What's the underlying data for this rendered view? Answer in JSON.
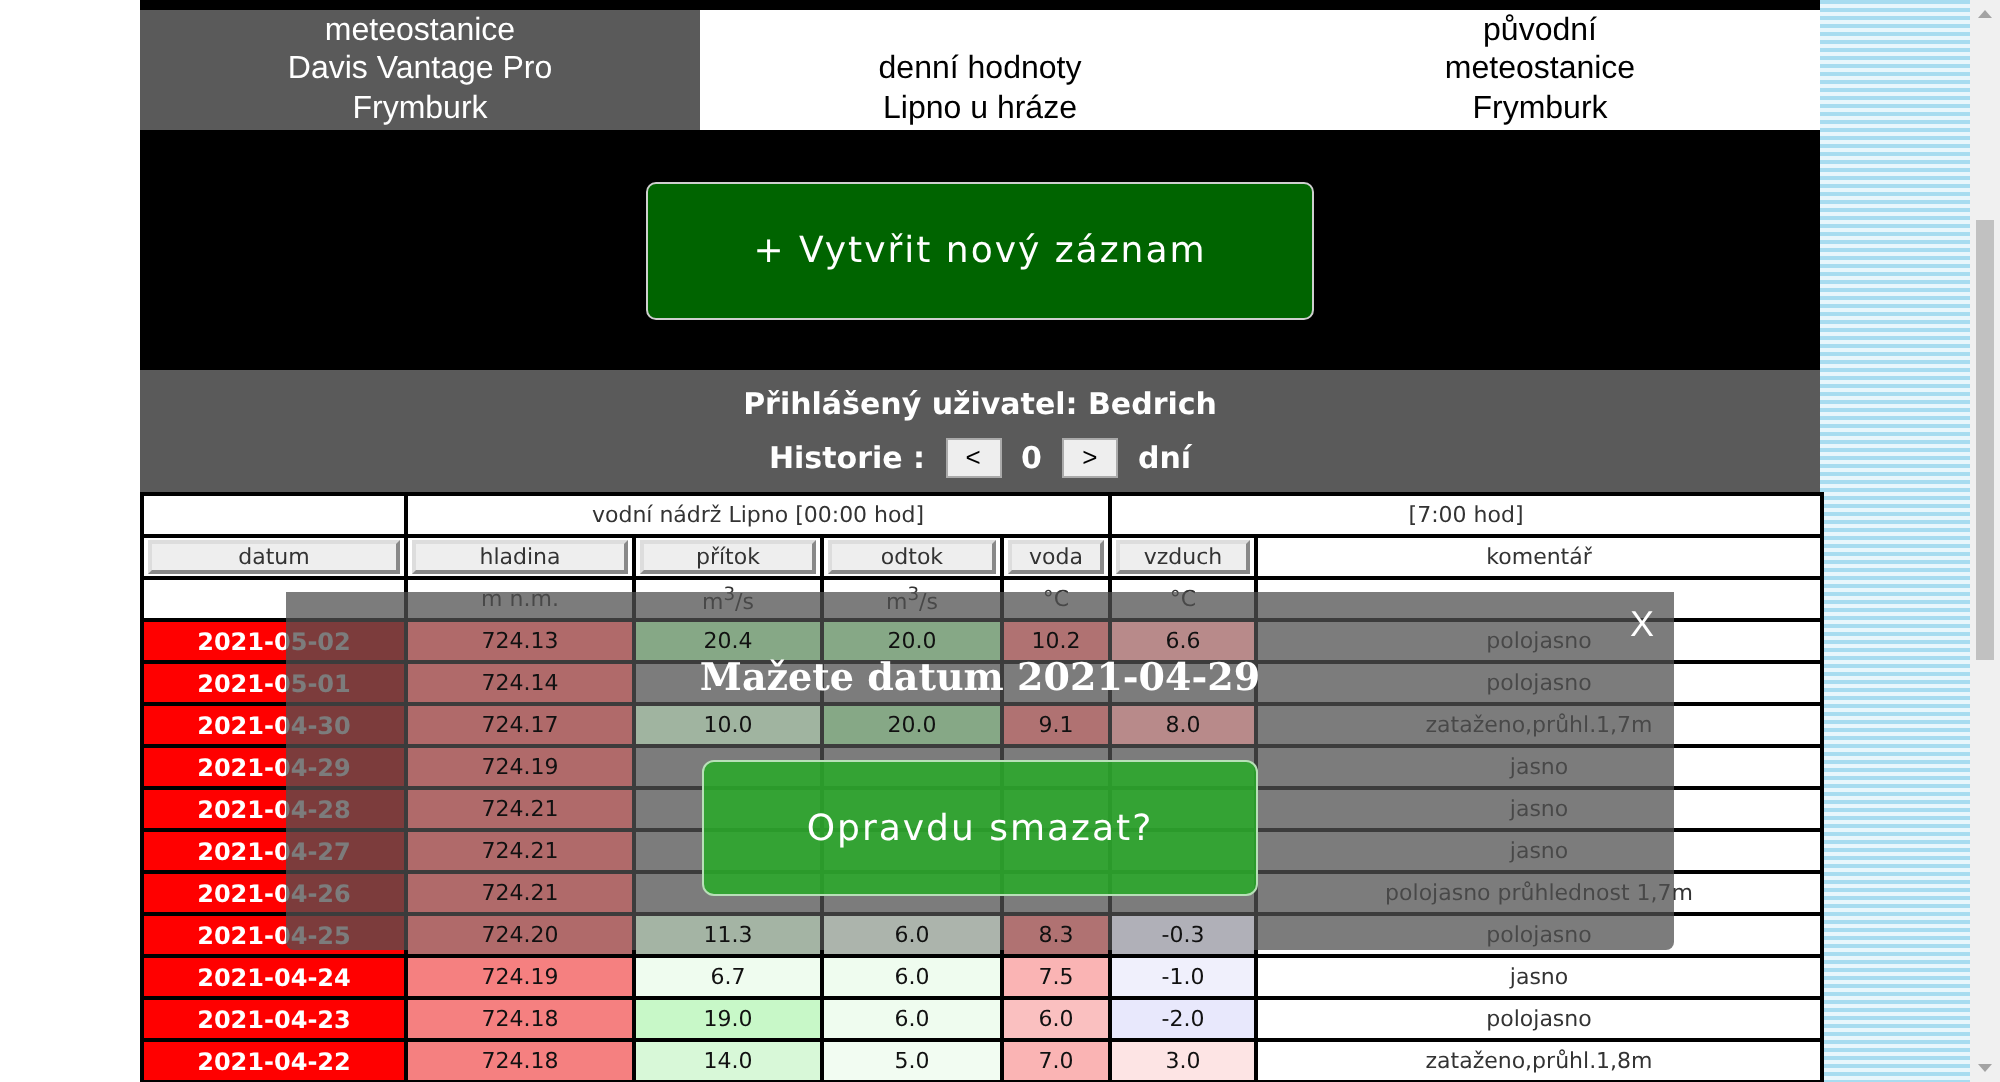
{
  "tabs": [
    {
      "lines": [
        "meteostanice",
        "Davis Vantage Pro",
        "Frymburk"
      ],
      "selected": true
    },
    {
      "lines": [
        "denní hodnoty",
        "Lipno u hráze"
      ],
      "selected": false
    },
    {
      "lines": [
        "původní",
        "meteostanice",
        "Frymburk"
      ],
      "selected": false
    }
  ],
  "create_button": "+ Vytvřit nový záznam",
  "user_label": "Přihlášený uživatel: Bedrich",
  "history": {
    "label": "Historie :",
    "prev": "<",
    "value": "0",
    "next": ">",
    "unit": "dní"
  },
  "table": {
    "groups": [
      "vodní nádrž Lipno [00:00 hod]",
      "[7:00 hod]"
    ],
    "columns": [
      {
        "label": "datum",
        "kind": "button"
      },
      {
        "label": "hladina",
        "kind": "button",
        "unit": "m n.m."
      },
      {
        "label": "přítok",
        "kind": "button",
        "unit": "m$^{3}$/s"
      },
      {
        "label": "odtok",
        "kind": "button",
        "unit": "m$^{3}$/s"
      },
      {
        "label": "voda",
        "kind": "button",
        "unit": "°C"
      },
      {
        "label": "vzduch",
        "kind": "button",
        "unit": "°C"
      },
      {
        "label": "komentář",
        "kind": "text"
      }
    ],
    "rows": [
      [
        {
          "text": "2021-05-02"
        },
        {
          "text": "724.13",
          "color": "#b06a6a"
        },
        {
          "text": "20.4",
          "color": "#86a886"
        },
        {
          "text": "20.0",
          "color": "#86a886"
        },
        {
          "text": "10.2",
          "color": "#b07272"
        },
        {
          "text": "6.6",
          "color": "#b88a8a"
        },
        {
          "text": "polojasno"
        }
      ],
      [
        {
          "text": "2021-05-01"
        },
        {
          "text": "724.14",
          "color": "#b06a6a"
        },
        {},
        {},
        {},
        {},
        {
          "text": "polojasno"
        }
      ],
      [
        {
          "text": "2021-04-30"
        },
        {
          "text": "724.17",
          "color": "#b06a6a"
        },
        {
          "text": "10.0",
          "color": "#a0b4a0"
        },
        {
          "text": "20.0",
          "color": "#86a886"
        },
        {
          "text": "9.1",
          "color": "#b07272"
        },
        {
          "text": "8.0",
          "color": "#b88a8a"
        },
        {
          "text": "zataženo,průhl.1,7m"
        }
      ],
      [
        {
          "text": "2021-04-29"
        },
        {
          "text": "724.19",
          "color": "#b06a6a"
        },
        {},
        {},
        {},
        {},
        {
          "text": "jasno"
        }
      ],
      [
        {
          "text": "2021-04-28"
        },
        {
          "text": "724.21",
          "color": "#b06a6a"
        },
        {},
        {},
        {},
        {},
        {
          "text": "jasno"
        }
      ],
      [
        {
          "text": "2021-04-27"
        },
        {
          "text": "724.21",
          "color": "#b06a6a"
        },
        {},
        {},
        {},
        {},
        {
          "text": "jasno"
        }
      ],
      [
        {
          "text": "2021-04-26"
        },
        {
          "text": "724.21",
          "color": "#b06a6a"
        },
        {},
        {},
        {},
        {},
        {
          "text": "polojasno průhlednost 1,7m"
        }
      ],
      [
        {
          "text": "2021-04-25"
        },
        {
          "text": "724.20",
          "color": "#b06a6a"
        },
        {
          "text": "11.3",
          "color": "#a4b4a4"
        },
        {
          "text": "6.0",
          "color": "#acb4ac"
        },
        {
          "text": "8.3",
          "color": "#b07272"
        },
        {
          "text": "-0.3",
          "color": "#b0b0b8"
        },
        {
          "text": "polojasno"
        }
      ],
      [
        {
          "text": "2021-04-24"
        },
        {
          "text": "724.19",
          "color": "#f58080"
        },
        {
          "text": "6.7",
          "color": "#effcef"
        },
        {
          "text": "6.0",
          "color": "#effcef"
        },
        {
          "text": "7.5",
          "color": "#fab4b4"
        },
        {
          "text": "-1.0",
          "color": "#f0f0fc"
        },
        {
          "text": "jasno"
        }
      ],
      [
        {
          "text": "2021-04-23"
        },
        {
          "text": "724.18",
          "color": "#f58080"
        },
        {
          "text": "19.0",
          "color": "#c8f8c8"
        },
        {
          "text": "6.0",
          "color": "#effcef"
        },
        {
          "text": "6.0",
          "color": "#fac0c0"
        },
        {
          "text": "-2.0",
          "color": "#e8e8fc"
        },
        {
          "text": "polojasno"
        }
      ],
      [
        {
          "text": "2021-04-22"
        },
        {
          "text": "724.18",
          "color": "#f58080"
        },
        {
          "text": "14.0",
          "color": "#d8f8d8"
        },
        {
          "text": "5.0",
          "color": "#f2fcf2"
        },
        {
          "text": "7.0",
          "color": "#fab4b4"
        },
        {
          "text": "3.0",
          "color": "#fde4e4"
        },
        {
          "text": "zataženo,průhl.1,8m"
        }
      ]
    ]
  },
  "dialog": {
    "close": "X",
    "title": "Mažete datum 2021-04-29",
    "confirm": "Opravdu smazat?"
  }
}
